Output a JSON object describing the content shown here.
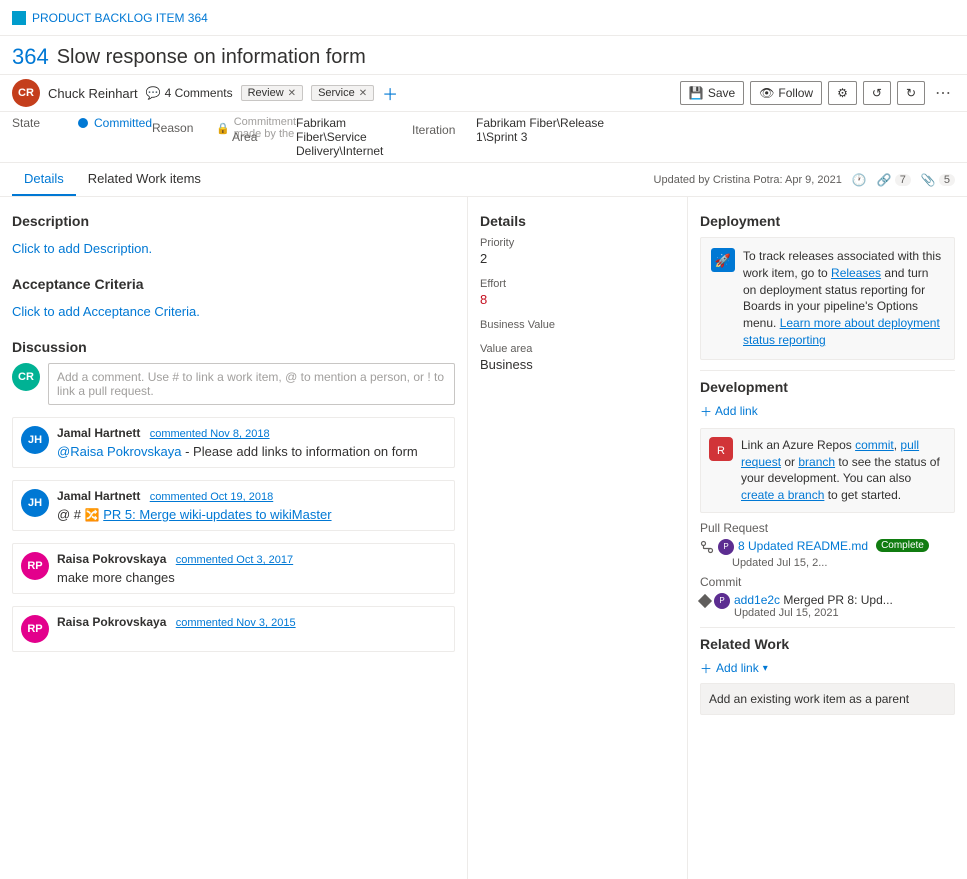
{
  "topbar": {
    "icon_color": "#009ccc",
    "title": "PRODUCT BACKLOG ITEM 364"
  },
  "header": {
    "item_number": "364",
    "item_title": "Slow response on information form"
  },
  "toolbar": {
    "avatar_initials": "CR",
    "user_name": "Chuck Reinhart",
    "comment_icon": "💬",
    "comment_count": "4 Comments",
    "tag1": "Review",
    "tag2": "Service",
    "save_label": "Save",
    "follow_label": "Follow",
    "settings_icon": "⚙",
    "undo_icon": "↺",
    "redo_icon": "↻",
    "more_icon": "⋯"
  },
  "meta": {
    "state_label": "State",
    "state_value": "Committed",
    "reason_label": "Reason",
    "reason_value": "Commitment made by the",
    "area_label": "Area",
    "area_value": "Fabrikam Fiber\\Service Delivery\\Internet",
    "iteration_label": "Iteration",
    "iteration_value": "Fabrikam Fiber\\Release 1\\Sprint 3"
  },
  "tabs": {
    "details_label": "Details",
    "related_work_label": "Related Work items",
    "history_icon": "🕐",
    "links_icon": "🔗",
    "links_count": "7",
    "attachments_icon": "📎",
    "attachments_count": "5",
    "updated_text": "Updated by Cristina Potra: Apr 9, 2021"
  },
  "description": {
    "section_title": "Description",
    "placeholder": "Click to add Description."
  },
  "acceptance": {
    "section_title": "Acceptance Criteria",
    "placeholder": "Click to add Acceptance Criteria."
  },
  "discussion": {
    "section_title": "Discussion",
    "input_placeholder": "Add a comment. Use # to link a work item, @ to mention a person, or ! to link a pull request.",
    "comments": [
      {
        "author": "Jamal Hartnett",
        "date": "commented Nov 8, 2018",
        "text": "@Raisa Pokrovskaya - Please add links to information on form",
        "avatar_initials": "JH",
        "avatar_color": "#0078d4"
      },
      {
        "author": "Jamal Hartnett",
        "date": "commented Oct 19, 2018",
        "text": "@ # 🔀 PR 5: Merge wiki-updates to wikiMaster",
        "avatar_initials": "JH",
        "avatar_color": "#0078d4"
      },
      {
        "author": "Raisa Pokrovskaya",
        "date": "commented Oct 3, 2017",
        "text": "make more changes",
        "avatar_initials": "RP",
        "avatar_color": "#e3008c"
      },
      {
        "author": "Raisa Pokrovskaya",
        "date": "commented Nov 3, 2015",
        "text": "",
        "avatar_initials": "RP",
        "avatar_color": "#e3008c"
      }
    ]
  },
  "details_panel": {
    "section_title": "Details",
    "priority_label": "Priority",
    "priority_value": "2",
    "effort_label": "Effort",
    "effort_value": "8",
    "business_value_label": "Business Value",
    "business_value_value": "",
    "value_area_label": "Value area",
    "value_area_value": "Business"
  },
  "deployment": {
    "section_title": "Deployment",
    "text": "To track releases associated with this work item, go to Releases and turn on deployment status reporting for Boards in your pipeline's Options menu. Learn more about deployment status reporting",
    "releases_link": "Releases",
    "learn_link": "Learn more about deployment status reporting"
  },
  "development": {
    "section_title": "Development",
    "add_link_label": "Add link",
    "dev_box_text": "Link an Azure Repos commit, pull request or branch to see the status of your development. You can also create a branch to get started.",
    "commit_link": "commit",
    "pull_request_link": "pull request",
    "branch_link": "branch",
    "create_branch_link": "create a branch",
    "pr_section_label": "Pull Request",
    "pr_item": {
      "pr_number": "8",
      "pr_title": "Updated README.md",
      "pr_date": "Updated Jul 15, 2...",
      "pr_status": "Complete",
      "avatar_initials": "P",
      "avatar_color": "#5c2d91"
    },
    "commit_section_label": "Commit",
    "commit_item": {
      "commit_hash": "add1e2c",
      "commit_title": "Merged PR 8: Upd...",
      "commit_date": "Updated Jul 15, 2021",
      "avatar_initials": "P",
      "avatar_color": "#5c2d91"
    }
  },
  "related_work": {
    "section_title": "Related Work",
    "add_link_label": "Add link",
    "existing_work_text": "Add an existing work item as a parent"
  }
}
